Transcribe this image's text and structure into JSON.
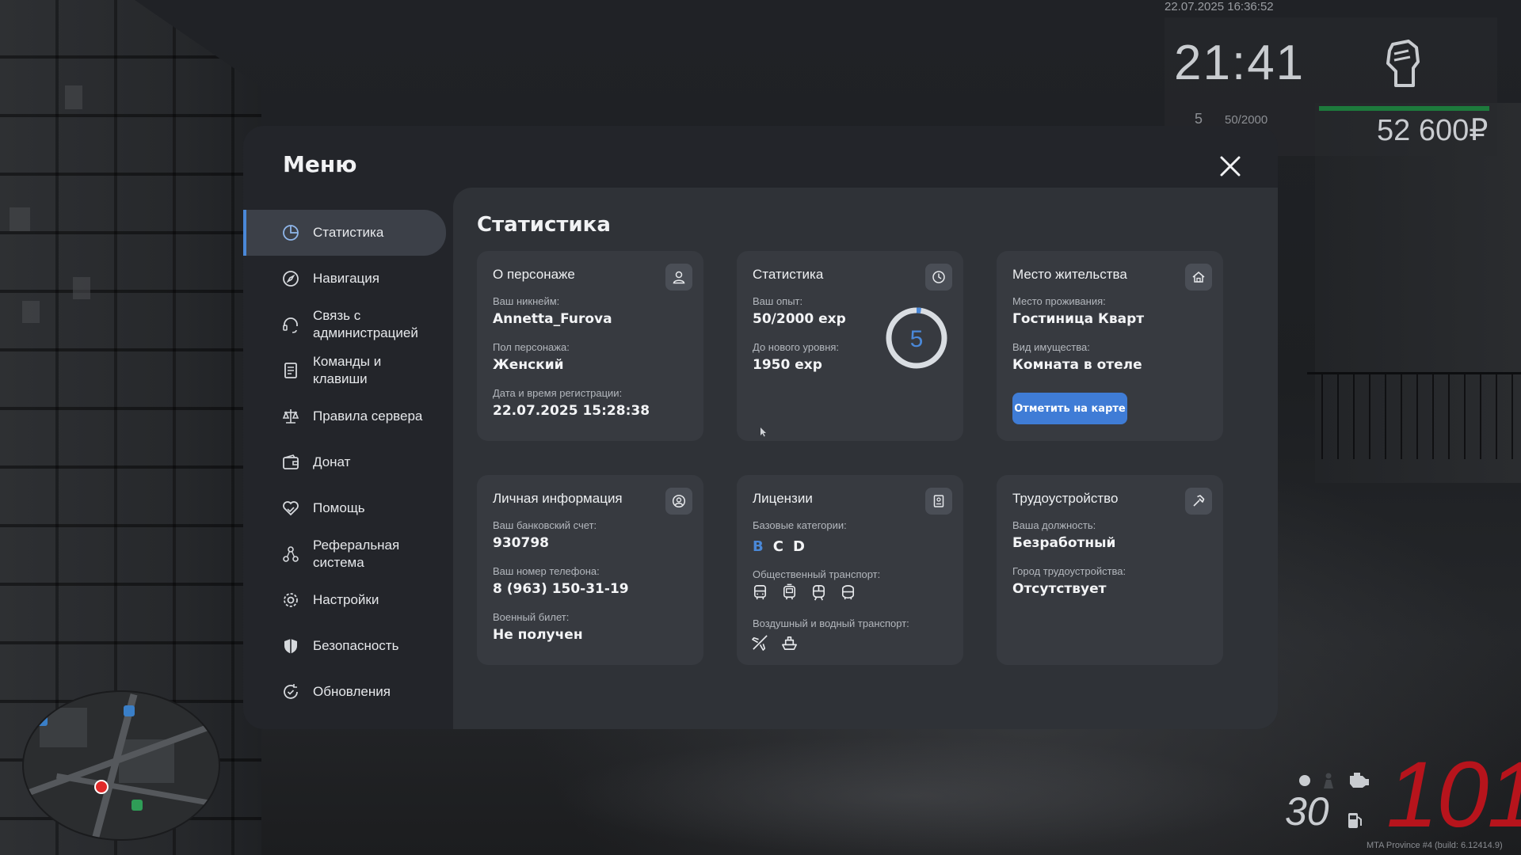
{
  "hud": {
    "datetime": "22.07.2025 16:36:52",
    "clock": "21:41",
    "level": "5",
    "exp": "50/2000",
    "money": "52 600₽",
    "speed": "101",
    "fuel": "30",
    "build": "MTA Province #4 (build: 6.12414.9)"
  },
  "menu": {
    "title": "Меню",
    "close_icon": "close-icon",
    "nav": [
      {
        "label": "Статистика",
        "icon": "pie-chart-icon",
        "active": true
      },
      {
        "label": "Навигация",
        "icon": "compass-icon"
      },
      {
        "label": "Связь с\nадминистрацией",
        "icon": "headset-icon"
      },
      {
        "label": "Команды и\nклавиши",
        "icon": "document-list-icon"
      },
      {
        "label": "Правила сервера",
        "icon": "scales-icon"
      },
      {
        "label": "Донат",
        "icon": "wallet-icon"
      },
      {
        "label": "Помощь",
        "icon": "heart-hand-icon"
      },
      {
        "label": "Реферальная\nсистема",
        "icon": "referral-icon"
      },
      {
        "label": "Настройки",
        "icon": "gear-icon"
      },
      {
        "label": "Безопасность",
        "icon": "shield-icon"
      },
      {
        "label": "Обновления",
        "icon": "refresh-check-icon"
      }
    ]
  },
  "content": {
    "title": "Статистика",
    "about": {
      "title": "О персонаже",
      "icon": "user-icon",
      "nick_label": "Ваш никнейм:",
      "nick": "Annetta_Furova",
      "gender_label": "Пол персонажа:",
      "gender": "Женский",
      "reg_label": "Дата и время регистрации:",
      "reg": "22.07.2025 15:28:38"
    },
    "stats": {
      "title": "Статистика",
      "icon": "clock-icon",
      "exp_label": "Ваш опыт:",
      "exp": "50/2000 exp",
      "next_label": "До нового уровня:",
      "next": "1950 exp",
      "level": "5",
      "progress": 0.025
    },
    "residence": {
      "title": "Место жительства",
      "icon": "house-icon",
      "place_label": "Место проживания:",
      "place": "Гостиница Кварт",
      "type_label": "Вид имущества:",
      "type": "Комната в отеле",
      "button": "Отметить на карте"
    },
    "personal": {
      "title": "Личная информация",
      "icon": "user-circle-icon",
      "bank_label": "Ваш банковский счет:",
      "bank": "930798",
      "phone_label": "Ваш номер телефона:",
      "phone": "8 (963) 150-31-19",
      "military_label": "Военный билет:",
      "military": "Не получен"
    },
    "licenses": {
      "title": "Лицензии",
      "icon": "id-card-icon",
      "base_label": "Базовые категории:",
      "categories": [
        {
          "name": "B",
          "active": true
        },
        {
          "name": "C",
          "active": false
        },
        {
          "name": "D",
          "active": false
        }
      ],
      "public_label": "Общественный транспорт:",
      "public_icons": [
        "bus-icon",
        "tram-icon",
        "train-icon",
        "trolleybus-icon"
      ],
      "air_label": "Воздушный и водный транспорт:",
      "air_icons": [
        "plane-icon",
        "boat-icon"
      ]
    },
    "job": {
      "title": "Трудоустройство",
      "icon": "hammer-icon",
      "position_label": "Ваша должность:",
      "position": "Безработный",
      "city_label": "Город трудоустройства:",
      "city": "Отсутствует"
    }
  },
  "colors": {
    "accent": "#4a88d8",
    "button": "#3f7cd6",
    "money_bar": "#1d7a3c",
    "speed": "#b7141c"
  }
}
